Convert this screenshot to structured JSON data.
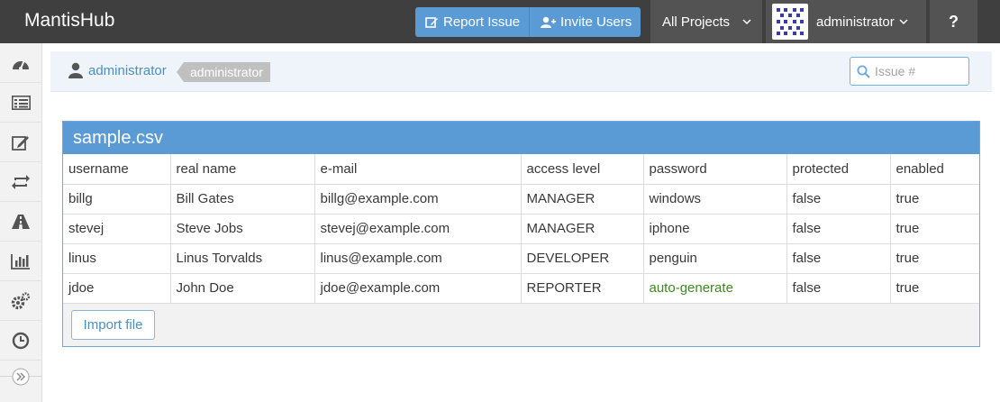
{
  "brand": "MantisHub",
  "nav": {
    "report_issue": "Report Issue",
    "invite_users": "Invite Users",
    "projects": "All Projects",
    "user": "administrator",
    "help": "?"
  },
  "sidebar": {
    "items": [
      "dashboard-icon",
      "view-issues-icon",
      "report-issue-icon",
      "changelog-icon",
      "roadmap-icon",
      "summary-icon",
      "manage-icon",
      "timeline-icon"
    ],
    "toggle": "collapse-sidebar-icon"
  },
  "breadcrumb": {
    "user_link": "administrator",
    "tag": "administrator",
    "search_placeholder": "Issue #"
  },
  "widget": {
    "title": "sample.csv",
    "columns": [
      "username",
      "real name",
      "e-mail",
      "access level",
      "password",
      "protected",
      "enabled"
    ],
    "rows": [
      [
        "billg",
        "Bill Gates",
        "billg@example.com",
        "MANAGER",
        "windows",
        "false",
        "true"
      ],
      [
        "stevej",
        "Steve Jobs",
        "stevej@example.com",
        "MANAGER",
        "iphone",
        "false",
        "true"
      ],
      [
        "linus",
        "Linus Torvalds",
        "linus@example.com",
        "DEVELOPER",
        "penguin",
        "false",
        "true"
      ],
      [
        "jdoe",
        "John Doe",
        "jdoe@example.com",
        "REPORTER",
        "auto-generate",
        "false",
        "true"
      ]
    ],
    "import_button": "Import file"
  },
  "colors": {
    "navbar": "#3f3f3f",
    "accent": "#5b9bd5",
    "link": "#4c8fbd",
    "auto_generate": "#3c8a1f"
  }
}
